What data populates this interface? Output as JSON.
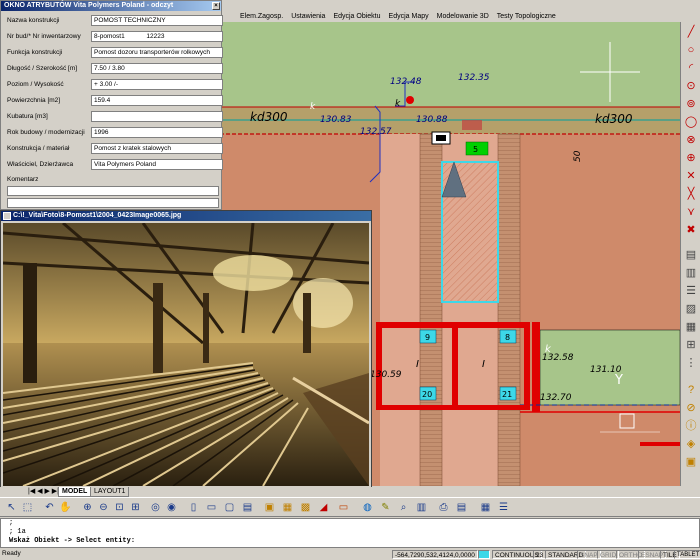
{
  "menu": [
    "Elem.Zagosp.",
    "Ustawienia",
    "Edycja Obiektu",
    "Edycja Mapy",
    "Modelowanie 3D",
    "Testy Topologiczne"
  ],
  "attr_window": {
    "title": "OKNO ATRYBUTÓW Vita Polymers Poland - odczyt",
    "rows": [
      {
        "label": "Nazwa konstrukcji",
        "value": "POMOST TECHNICZNY"
      },
      {
        "label": "Nr bud/*  Nr inwentarzowy",
        "value": "8-pomost1            12223"
      },
      {
        "label": "Funkcja konstrukcji",
        "value": "Pomost dozoru transporterów rolkowych"
      },
      {
        "label": "Długość / Szerokość [m]",
        "value": "7.50 / 3.80"
      },
      {
        "label": "Poziom / Wysokość",
        "value": "+ 3.00 /-"
      },
      {
        "label": "Powierzchnia  [m2]",
        "value": "159.4"
      },
      {
        "label": "Kubatura   [m3]",
        "value": ""
      },
      {
        "label": "Rok budowy / modernizacji",
        "value": "1996"
      },
      {
        "label": "Konstrukcja / materiał",
        "value": "Pomost z kratek stalowych"
      },
      {
        "label": "Właściciel, Dzierżawca",
        "value": "Vita Polymers Poland"
      }
    ],
    "comment_label": "Komentarz",
    "comment_value": ""
  },
  "photo_window": {
    "title": "C:\\!_Vita\\Foto\\8-Pomost1\\2004_0423Image0065.jpg"
  },
  "cad": {
    "labels": [
      "132.48",
      "132.35",
      "130.83",
      "130.88",
      "132.57",
      "kd300",
      "kd300",
      "k",
      "k",
      "k",
      "5",
      "9",
      "8",
      "20",
      "21",
      "132.58",
      "132.70",
      "131.10",
      "130.59",
      "Y",
      "I",
      "I",
      "50"
    ],
    "box_green": "5"
  },
  "tabs": [
    "MODEL",
    "LAYOUT1"
  ],
  "command": {
    "line1": ";",
    "line2": "; 1a",
    "line3": "Wskaż Obiekt ->  Select entity:"
  },
  "status": {
    "ready": "Ready",
    "coords": "-564,7290,532,4124,0,0000",
    "linetype": "CONTINUOUS",
    "lineweight": "23",
    "style": "STANDARD",
    "modes": [
      "SNAP",
      "GRID",
      "ORTHO",
      "ESNAP",
      "TILE",
      "TABLET"
    ]
  },
  "colors": {
    "cad_bg": "#a7c58a",
    "building": "#cf8a6a",
    "title_bar": "#0a246a",
    "red": "#e00000",
    "cyan": "#3dd8e8"
  }
}
